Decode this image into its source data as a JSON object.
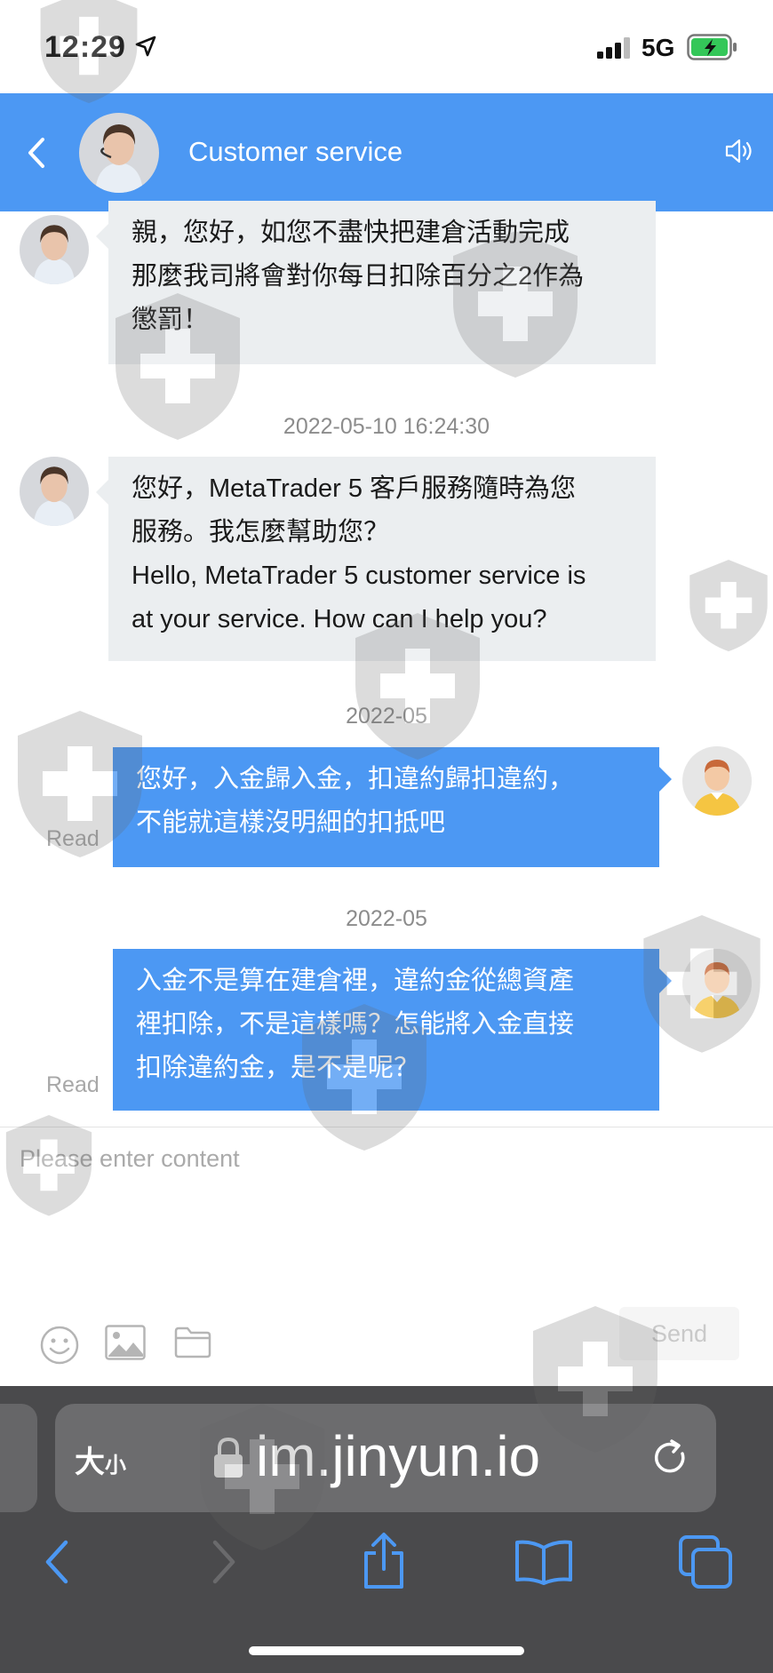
{
  "status_bar": {
    "time": "12:29",
    "network": "5G"
  },
  "header": {
    "title": "Customer service"
  },
  "messages": [
    {
      "side": "in",
      "lines": [
        "親，您好，如您不盡快把建倉活動完成",
        "那麼我司將會對你每日扣除百分之2作為",
        "懲罰！"
      ]
    },
    {
      "timestamp": "2022-05-10 16:24:30"
    },
    {
      "side": "in",
      "lines": [
        "您好，MetaTrader 5 客戶服務隨時為您",
        "服務。我怎麼幫助您？",
        "Hello, MetaTrader 5 customer service is",
        "at your service. How can I help you?"
      ]
    },
    {
      "timestamp": "2022-05"
    },
    {
      "side": "out",
      "lines": [
        "您好，入金歸入金，扣違約歸扣違約，",
        "不能就這樣沒明細的扣抵吧"
      ],
      "status": "Read"
    },
    {
      "timestamp": "2022-05"
    },
    {
      "side": "out",
      "lines": [
        "入金不是算在建倉裡，違約金從總資產",
        "裡扣除，不是這樣嗎？怎能將入金直接",
        "扣除違約金，是不是呢？"
      ],
      "status": "Read"
    }
  ],
  "input": {
    "placeholder": "Please enter content",
    "send_label": "Send"
  },
  "toolbar_icons": [
    "emoji-icon",
    "image-icon",
    "folder-icon"
  ],
  "browser": {
    "aa_big": "大",
    "aa_small": "小",
    "url": "im.jinyun.io"
  },
  "colors": {
    "accent": "#4c98f3",
    "incoming_bubble": "#ebeef0",
    "browser_chrome": "#4a4a4c"
  }
}
